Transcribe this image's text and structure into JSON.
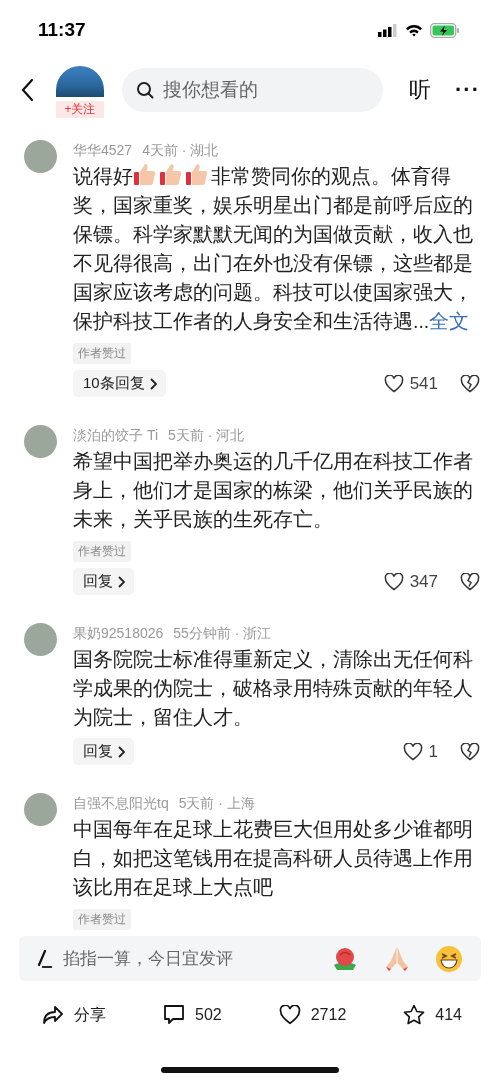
{
  "status_bar": {
    "time": "11:37"
  },
  "nav": {
    "follow_label": "+关注",
    "search_placeholder": "搜你想看的",
    "listen_label": "听",
    "more_label": "···"
  },
  "comments": [
    {
      "author": "华华4527",
      "posted": "4天前 · 湖北",
      "text_lead": "说得好",
      "reaction_icons": [
        {
          "kind": "thumbs-up"
        },
        {
          "kind": "thumbs-up"
        },
        {
          "kind": "thumbs-up"
        }
      ],
      "text": "非常赞同你的观点。体育得奖，国家重奖，娱乐明星出门都是前呼后应的保镖。科学家默默无闻的为国做贡献，收入也不见得很高，出门在外也没有保镖，这些都是国家应该考虑的问题。科技可以使国家强大，保护科技工作者的人身安全和生活待遇...",
      "more_link": "全文",
      "badge": "作者赞过",
      "reply_label": "10条回复",
      "likes": "541"
    },
    {
      "author": "淡泊的饺子 Ti",
      "posted": "5天前 · 河北",
      "text": "希望中国把举办奥运的几千亿用在科技工作者身上，他们才是国家的栋梁，他们关乎民族的未来，关乎民族的生死存亡。",
      "badge": "作者赞过",
      "reply_label": "回复",
      "likes": "347"
    },
    {
      "author": "果奶92518026",
      "posted": "55分钟前 · 浙江",
      "text": "国务院院士标准得重新定义，清除出无任何科学成果的伪院士，破格录用特殊贡献的年轻人为院士，留住人才。",
      "reply_label": "回复",
      "likes": "1"
    },
    {
      "author": "自强不息阳光tq",
      "posted": "5天前 · 上海",
      "text": "中国每年在足球上花费巨大但用处多少谁都明白，如把这笔钱用在提高科研人员待遇上作用该比用在足球上大点吧",
      "badge": "作者赞过"
    }
  ],
  "comment_input": {
    "placeholder": "掐指一算，今日宜发评",
    "emoji": [
      {
        "kind": "rose"
      },
      {
        "kind": "pray"
      },
      {
        "kind": "grin"
      }
    ]
  },
  "action_bar": [
    {
      "kind": "share",
      "label": "分享"
    },
    {
      "kind": "comment",
      "label": "502"
    },
    {
      "kind": "like",
      "label": "2712"
    },
    {
      "kind": "favorite",
      "label": "414"
    }
  ]
}
